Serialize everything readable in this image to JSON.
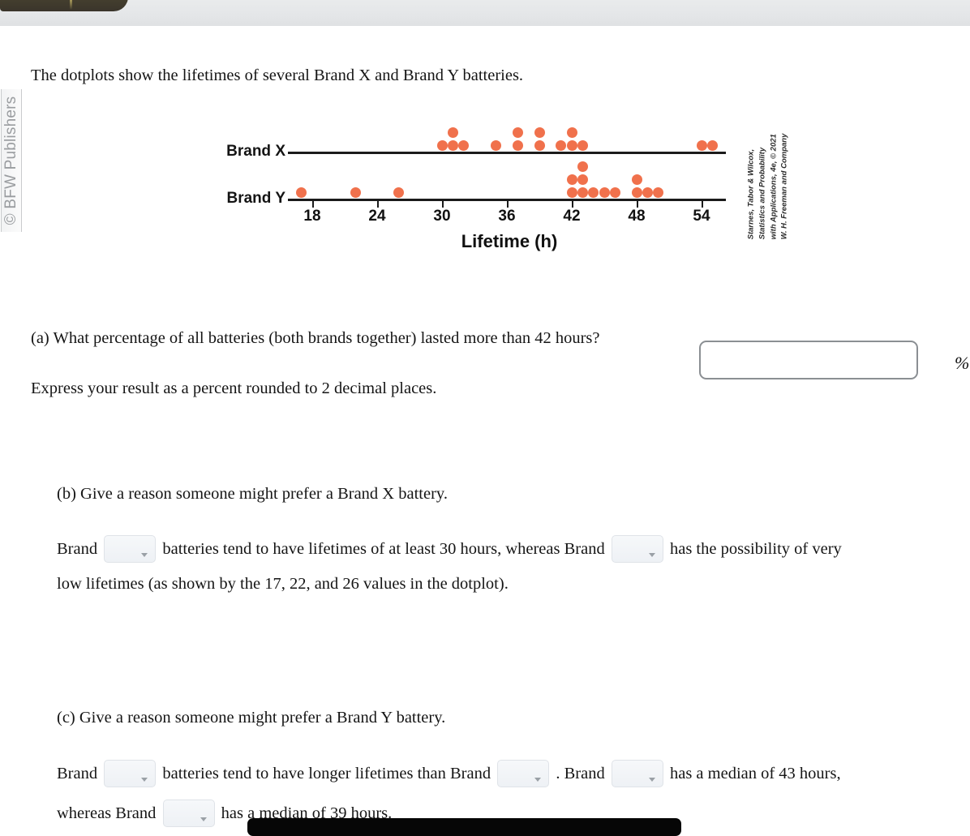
{
  "chrome": {
    "publisher_credit": "© BFW Publishers"
  },
  "intro": "The dotplots show the lifetimes of several Brand X and Brand Y batteries.",
  "figure": {
    "source_credit_lines": [
      "Starnes, Tabor & Wilcox,",
      "Statistics and Probability",
      "with Applications, 4e, © 2021",
      "W. H. Freeman and Company"
    ],
    "dot_color": "#f0714c"
  },
  "chart_data": {
    "type": "scatter",
    "title": "",
    "xlabel": "Lifetime (h)",
    "ylabel": "",
    "xlim": [
      15,
      57
    ],
    "ticks": [
      18,
      24,
      30,
      36,
      42,
      48,
      54
    ],
    "grid": false,
    "legend_position": "left-axis-labels",
    "series": [
      {
        "name": "Brand X",
        "values": [
          30,
          31,
          31,
          32,
          35,
          37,
          37,
          39,
          39,
          41,
          42,
          42,
          43,
          54,
          55
        ]
      },
      {
        "name": "Brand Y",
        "values": [
          17,
          22,
          26,
          42,
          42,
          43,
          43,
          43,
          44,
          45,
          46,
          48,
          48,
          49,
          50
        ]
      }
    ]
  },
  "question_a": {
    "prompt": "(a) What percentage of all batteries (both brands together) lasted more than 42 hours?",
    "note": "Express your result as a percent rounded to 2 decimal places.",
    "answer_value": "",
    "unit_label": "%"
  },
  "question_b": {
    "prompt": "(b) Give a reason someone might prefer a Brand X battery.",
    "line1_part1": "Brand",
    "dropdown1_value": "",
    "line1_part2": "batteries tend to have lifetimes of at least 30 hours, whereas Brand",
    "dropdown2_value": "",
    "line1_part3": "has the possibility of very",
    "line2": "low lifetimes (as shown by the 17, 22, and 26 values in the dotplot)."
  },
  "question_c": {
    "prompt": "(c) Give a reason someone might prefer a Brand Y battery.",
    "line1_part1": "Brand",
    "dropdown1_value": "",
    "line1_part2": "batteries tend to have longer lifetimes than Brand",
    "dropdown2_value": "",
    "line1_part3": ". Brand",
    "dropdown3_value": "",
    "line1_part4": "has a median of 43 hours,",
    "line2_part1": "whereas Brand",
    "dropdown4_value": "",
    "line2_part2": "has a median of 39 hours."
  }
}
